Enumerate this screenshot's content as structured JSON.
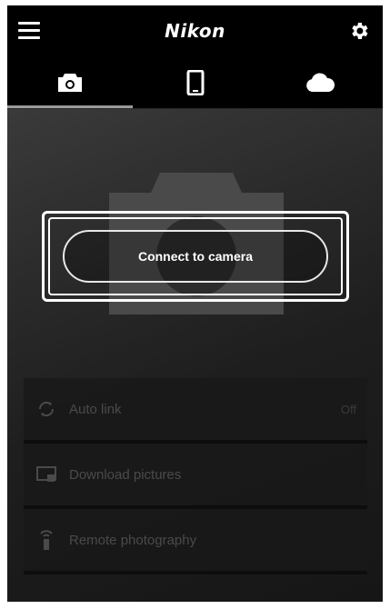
{
  "header": {
    "brand": "Nikon"
  },
  "tabs": [
    {
      "icon": "camera-icon",
      "active": true
    },
    {
      "icon": "smartphone-icon",
      "active": false
    },
    {
      "icon": "cloud-icon",
      "active": false
    }
  ],
  "main": {
    "connect_label": "Connect to camera"
  },
  "list": [
    {
      "icon": "auto-link-icon",
      "label": "Auto link",
      "value": "Off"
    },
    {
      "icon": "download-pictures-icon",
      "label": "Download pictures"
    },
    {
      "icon": "remote-photography-icon",
      "label": "Remote photography"
    }
  ],
  "colors": {
    "background": "#000000",
    "text": "#ffffff",
    "dimmed_text": "#4a4a4a",
    "tab_indicator": "#9a9a9a"
  }
}
